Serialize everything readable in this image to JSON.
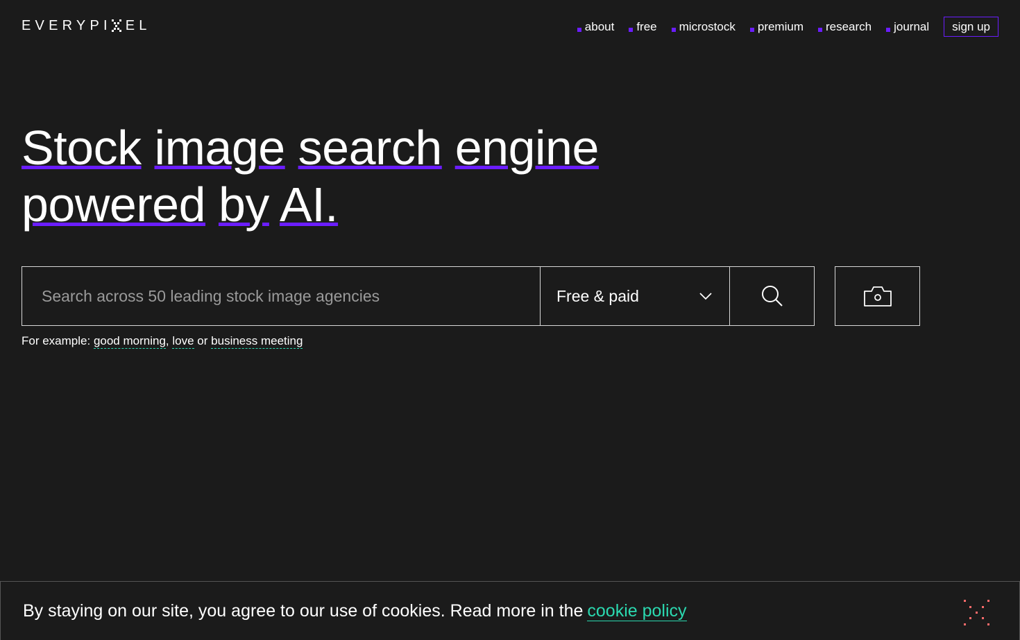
{
  "header": {
    "logo_text_left": "EVERYPI",
    "logo_text_right": "EL",
    "nav": [
      "about",
      "free",
      "microstock",
      "premium",
      "research",
      "journal"
    ],
    "signup_label": "sign up"
  },
  "hero": {
    "line1": [
      "Stock",
      "image",
      "search",
      "engine"
    ],
    "line2": [
      "powered",
      "by",
      "AI."
    ]
  },
  "search": {
    "placeholder": "Search across 50 leading stock image agencies",
    "value": "",
    "license_selected": "Free & paid"
  },
  "examples": {
    "prefix": "For example:",
    "items": [
      "good morning",
      "love",
      "business meeting"
    ],
    "sep1": ",",
    "sep2": "or"
  },
  "cookie": {
    "text": "By staying on our site, you agree to our use of cookies. Read more in the",
    "link": "cookie policy"
  },
  "colors": {
    "accent": "#6b1dff",
    "link": "#2bd9b0",
    "background": "#1b1b1b",
    "close": "#ff6b6b"
  },
  "icons": [
    "search-icon",
    "camera-icon",
    "chevron-down-icon",
    "close-icon"
  ]
}
